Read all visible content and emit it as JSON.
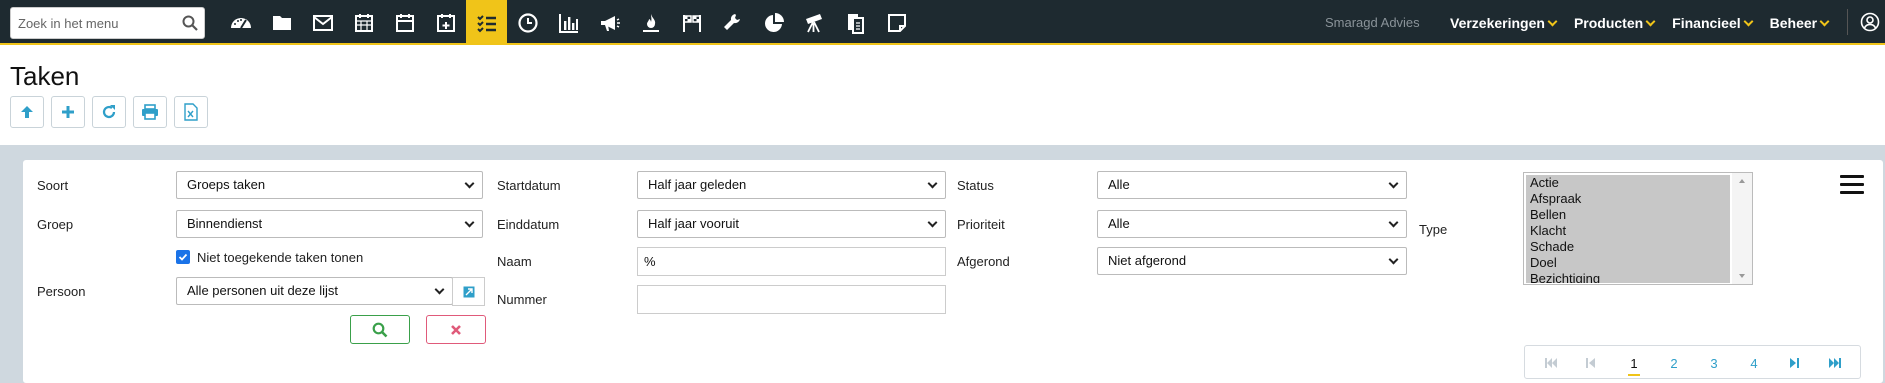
{
  "search": {
    "placeholder": "Zoek in het menu"
  },
  "nav_icons": [
    "dashboard-icon",
    "folder-icon",
    "mail-icon",
    "calendar-icon",
    "calendar-blank-icon",
    "calendar-plus-icon",
    "tasks-icon",
    "clock-icon",
    "bar-chart-icon",
    "megaphone-icon",
    "fire-icon",
    "flags-icon",
    "wrench-icon",
    "pie-chart-icon",
    "telescope-icon",
    "documents-icon",
    "note-icon"
  ],
  "active_nav_icon": "tasks-icon",
  "company": "Smaragd Advies",
  "menus": [
    "Verzekeringen",
    "Producten",
    "Financieel",
    "Beheer"
  ],
  "page": {
    "title": "Taken"
  },
  "toolbar_icons": [
    "arrow-up-icon",
    "plus-icon",
    "refresh-icon",
    "print-icon",
    "excel-icon"
  ],
  "filters": {
    "soort": {
      "label": "Soort",
      "value": "Groeps taken"
    },
    "groep": {
      "label": "Groep",
      "value": "Binnendienst"
    },
    "niet_toegekend": {
      "label": "Niet toegekende taken tonen",
      "checked": true
    },
    "persoon": {
      "label": "Persoon",
      "value": "Alle personen uit deze lijst"
    },
    "startdatum": {
      "label": "Startdatum",
      "value": "Half jaar geleden"
    },
    "einddatum": {
      "label": "Einddatum",
      "value": "Half jaar vooruit"
    },
    "naam": {
      "label": "Naam",
      "value": "%"
    },
    "nummer": {
      "label": "Nummer",
      "value": ""
    },
    "status": {
      "label": "Status",
      "value": "Alle"
    },
    "prioriteit": {
      "label": "Prioriteit",
      "value": "Alle"
    },
    "afgerond": {
      "label": "Afgerond",
      "value": "Niet afgerond"
    },
    "type": {
      "label": "Type",
      "options": [
        "Actie",
        "Afspraak",
        "Bellen",
        "Klacht",
        "Schade",
        "Doel",
        "Bezichtiging"
      ]
    }
  },
  "pager": {
    "pages": [
      "1",
      "2",
      "3",
      "4"
    ],
    "current": "1"
  },
  "colors": {
    "topbar": "#1e2a30",
    "accent": "#f0c419",
    "link": "#2f9fc9",
    "search_btn": "#3aa04a",
    "clear_btn": "#e05a7a"
  }
}
